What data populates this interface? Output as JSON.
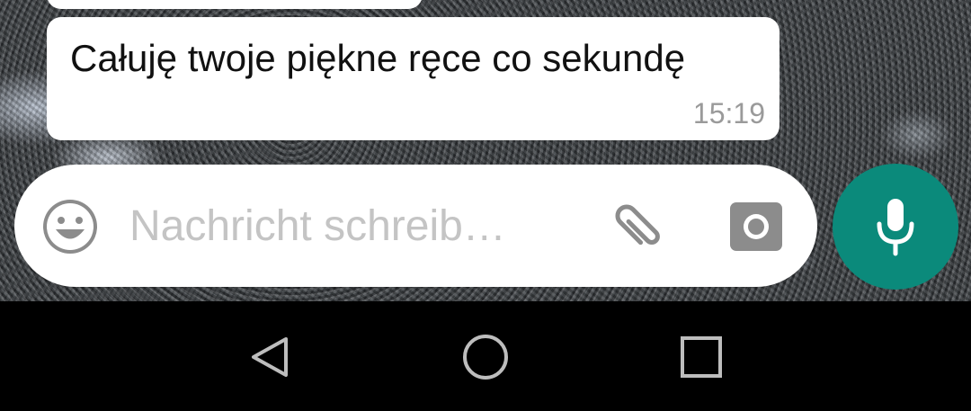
{
  "chat": {
    "message": {
      "text": "Całuję twoje piękne ręce co sekundę",
      "time": "15:19"
    }
  },
  "composer": {
    "placeholder": "Nachricht schreib…",
    "value": "",
    "emoji_icon": "smiley-icon",
    "attach_icon": "paperclip-icon",
    "camera_icon": "camera-icon",
    "mic_icon": "microphone-icon"
  },
  "colors": {
    "accent": "#0b8a7b",
    "bubble": "#ffffff",
    "timestamp": "#9a9a9a",
    "placeholder": "#c4c4c4",
    "icon": "#8c8c8c",
    "nav_bar": "#000000"
  },
  "nav": {
    "back_icon": "back-triangle-icon",
    "home_icon": "home-circle-icon",
    "recents_icon": "recents-square-icon"
  }
}
